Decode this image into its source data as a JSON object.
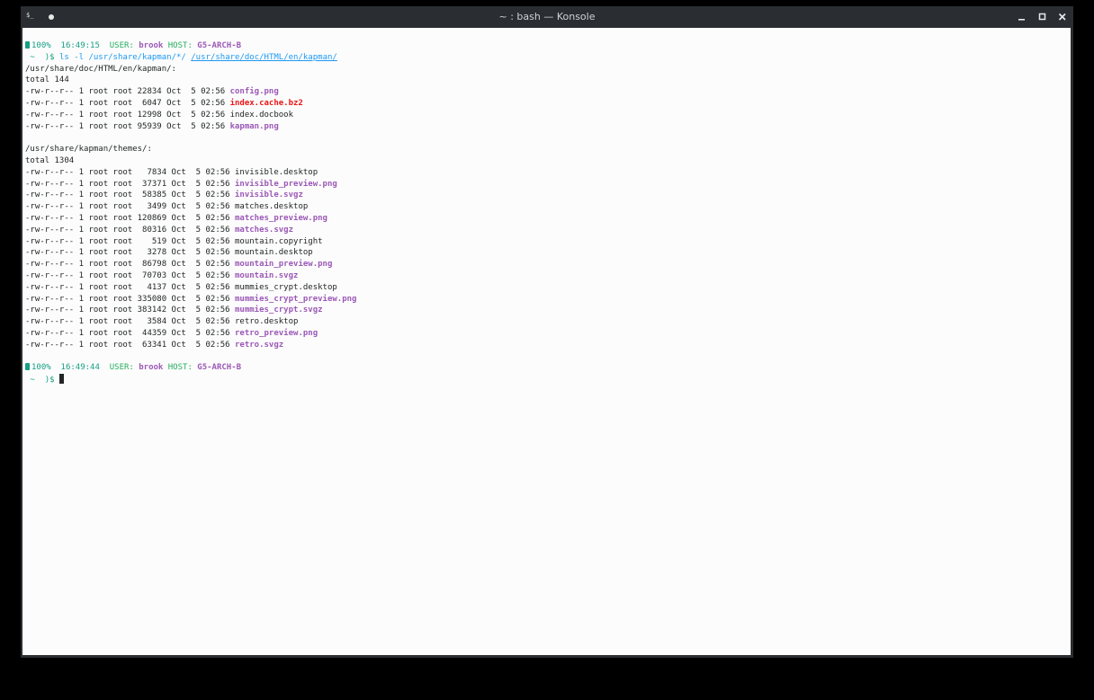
{
  "window": {
    "title": "~ : bash — Konsole"
  },
  "icons": {
    "app": "terminal-icon",
    "pin": "pin-icon",
    "minimize": "minimize-icon",
    "maximize": "maximize-icon",
    "close": "close-icon"
  },
  "colors": {
    "prompt_teal": "#16a085",
    "prompt_green": "#27ae60",
    "highlight_purple": "#9b59b6",
    "path_blue": "#1d99f3",
    "archive_red": "#ed1515",
    "background": "#fcfcfc",
    "text": "#232627"
  },
  "prompt1": {
    "battery": "100%",
    "time": "16:49:15",
    "user_label": "USER:",
    "user": "brook",
    "host_label": "HOST:",
    "host": "G5-ARCH-B",
    "dir": "~",
    "symbol": ")$",
    "command": "ls -l",
    "arg1": "/usr/share/kapman/*/",
    "arg2": "/usr/share/doc/HTML/en/kapman/"
  },
  "section1": {
    "header": "/usr/share/doc/HTML/en/kapman/:",
    "total": "total 144",
    "files": [
      {
        "meta": "-rw-r--r-- 1 root root 22834 Oct  5 02:56 ",
        "name": "config.png"
      },
      {
        "meta": "-rw-r--r-- 1 root root  6047 Oct  5 02:56 ",
        "name": "index.cache.bz2"
      },
      {
        "meta": "-rw-r--r-- 1 root root 12998 Oct  5 02:56 ",
        "name": "index.docbook"
      },
      {
        "meta": "-rw-r--r-- 1 root root 95939 Oct  5 02:56 ",
        "name": "kapman.png"
      }
    ]
  },
  "section2": {
    "header": "/usr/share/kapman/themes/:",
    "total": "total 1304",
    "files": [
      {
        "meta": "-rw-r--r-- 1 root root   7834 Oct  5 02:56 ",
        "name": "invisible.desktop"
      },
      {
        "meta": "-rw-r--r-- 1 root root  37371 Oct  5 02:56 ",
        "name": "invisible_preview.png"
      },
      {
        "meta": "-rw-r--r-- 1 root root  58385 Oct  5 02:56 ",
        "name": "invisible.svgz"
      },
      {
        "meta": "-rw-r--r-- 1 root root   3499 Oct  5 02:56 ",
        "name": "matches.desktop"
      },
      {
        "meta": "-rw-r--r-- 1 root root 120869 Oct  5 02:56 ",
        "name": "matches_preview.png"
      },
      {
        "meta": "-rw-r--r-- 1 root root  80316 Oct  5 02:56 ",
        "name": "matches.svgz"
      },
      {
        "meta": "-rw-r--r-- 1 root root    519 Oct  5 02:56 ",
        "name": "mountain.copyright"
      },
      {
        "meta": "-rw-r--r-- 1 root root   3278 Oct  5 02:56 ",
        "name": "mountain.desktop"
      },
      {
        "meta": "-rw-r--r-- 1 root root  86798 Oct  5 02:56 ",
        "name": "mountain_preview.png"
      },
      {
        "meta": "-rw-r--r-- 1 root root  70703 Oct  5 02:56 ",
        "name": "mountain.svgz"
      },
      {
        "meta": "-rw-r--r-- 1 root root   4137 Oct  5 02:56 ",
        "name": "mummies_crypt.desktop"
      },
      {
        "meta": "-rw-r--r-- 1 root root 335080 Oct  5 02:56 ",
        "name": "mummies_crypt_preview.png"
      },
      {
        "meta": "-rw-r--r-- 1 root root 383142 Oct  5 02:56 ",
        "name": "mummies_crypt.svgz"
      },
      {
        "meta": "-rw-r--r-- 1 root root   3584 Oct  5 02:56 ",
        "name": "retro.desktop"
      },
      {
        "meta": "-rw-r--r-- 1 root root  44359 Oct  5 02:56 ",
        "name": "retro_preview.png"
      },
      {
        "meta": "-rw-r--r-- 1 root root  63341 Oct  5 02:56 ",
        "name": "retro.svgz"
      }
    ]
  },
  "prompt2": {
    "battery": "100%",
    "time": "16:49:44",
    "user_label": "USER:",
    "user": "brook",
    "host_label": "HOST:",
    "host": "G5-ARCH-B",
    "dir": "~",
    "symbol": ")$"
  }
}
